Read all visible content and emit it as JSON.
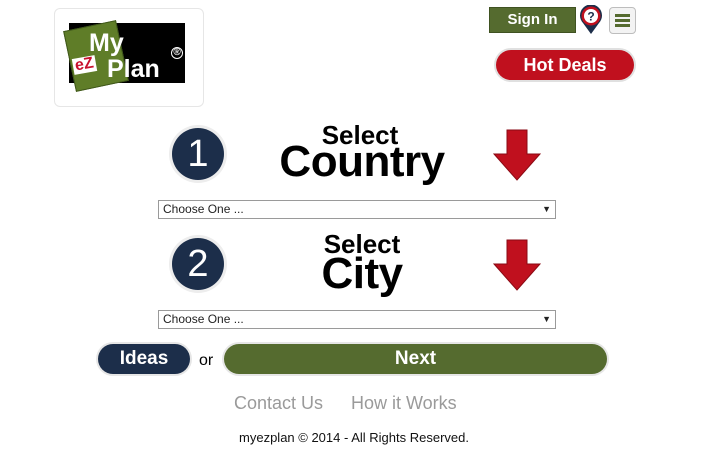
{
  "logo": {
    "my": "My",
    "ez": "eZ",
    "plan": "Plan",
    "reg": "®"
  },
  "header": {
    "signin_label": "Sign In",
    "help_icon": "help-pin-icon",
    "menu_icon": "hamburger-menu-icon",
    "hot_deals_label": "Hot Deals"
  },
  "steps": [
    {
      "number": "1",
      "line1": "Select",
      "line2": "Country",
      "arrow_icon": "down-arrow-icon",
      "dropdown_value": "Choose One ..."
    },
    {
      "number": "2",
      "line1": "Select",
      "line2": "City",
      "arrow_icon": "down-arrow-icon",
      "dropdown_value": "Choose One ..."
    }
  ],
  "actions": {
    "ideas_label": "Ideas",
    "or_text": "or",
    "next_label": "Next"
  },
  "footer": {
    "contact_label": "Contact Us",
    "how_label": "How it Works",
    "copyright": "myezplan © 2014 - All Rights Reserved."
  },
  "colors": {
    "olive": "#556b2f",
    "navy": "#1c2e4a",
    "red": "#c0101e"
  }
}
